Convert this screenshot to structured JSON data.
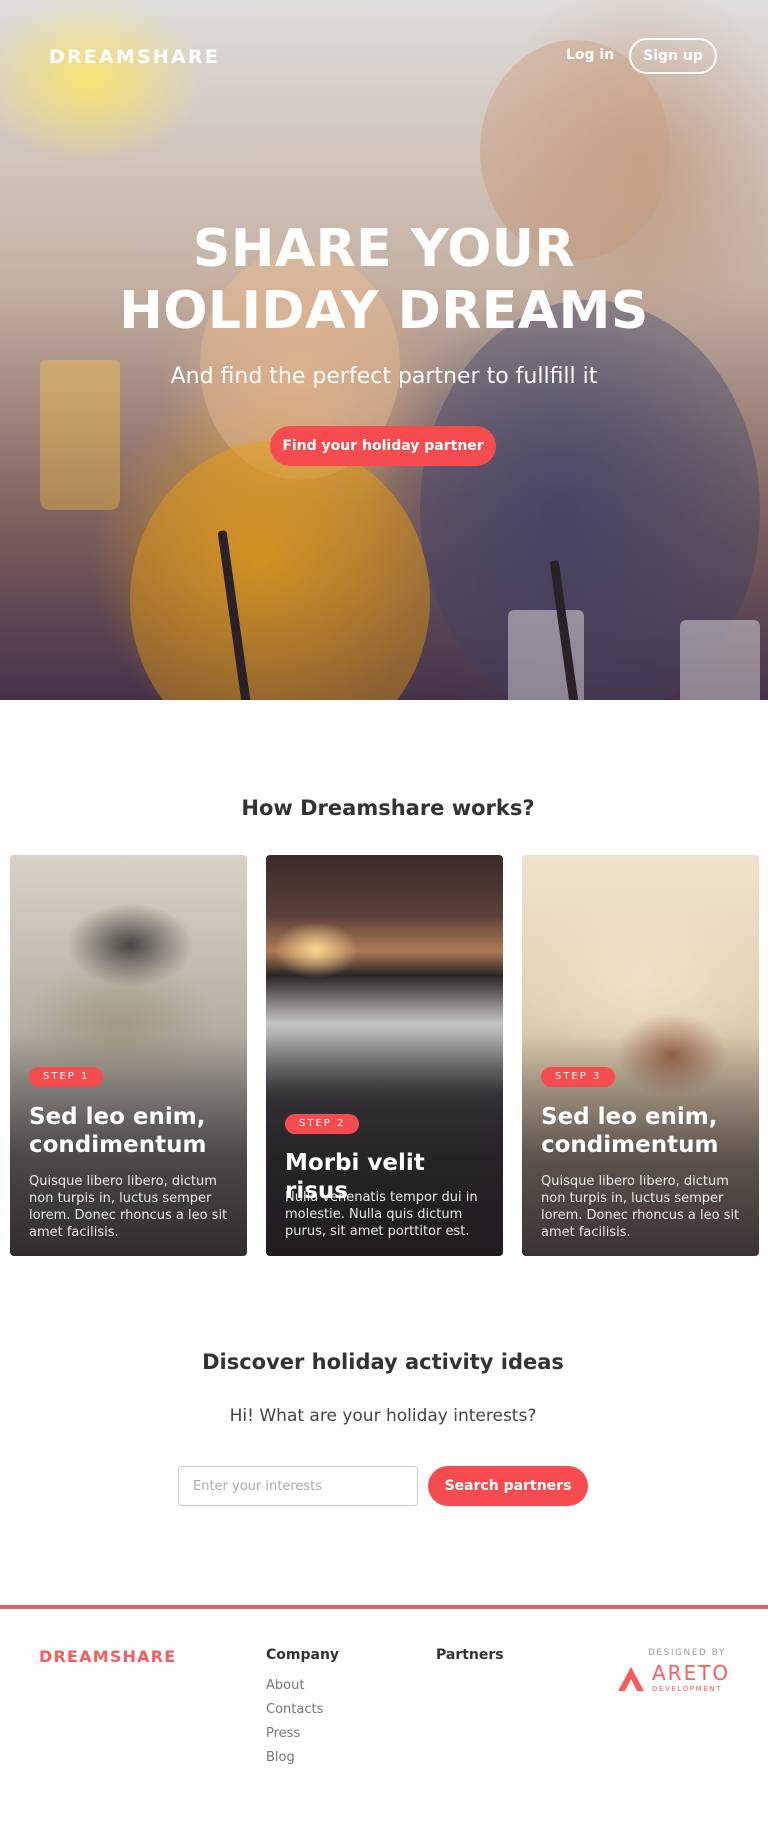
{
  "nav": {
    "logo": "DREAMSHARE",
    "login": "Log in",
    "signup": "Sign up"
  },
  "hero": {
    "title_line1": "SHARE YOUR",
    "title_line2": "HOLIDAY DREAMS",
    "subtitle": "And find the perfect partner to fullfill it",
    "cta": "Find your holiday partner"
  },
  "how": {
    "title": "How Dreamshare works?",
    "cards": [
      {
        "step": "STEP 1",
        "title": "Sed leo enim, condimentum",
        "text": "Quisque libero libero, dictum non turpis in, luctus semper lorem. Donec rhoncus a leo sit amet facilisis."
      },
      {
        "step": "STEP 2",
        "title": "Morbi velit risus",
        "text": "Nulla venenatis tempor dui in molestie. Nulla quis dictum purus, sit amet porttitor est."
      },
      {
        "step": "STEP 3",
        "title": "Sed leo enim, condimentum",
        "text": "Quisque libero libero, dictum non turpis in, luctus semper lorem. Donec rhoncus a leo sit amet facilisis."
      }
    ]
  },
  "discover": {
    "title": "Discover holiday activity ideas",
    "subtitle": "Hi! What are your holiday interests?",
    "input_placeholder": "Enter your interests",
    "button": "Search partners"
  },
  "footer": {
    "logo": "DREAMSHARE",
    "company_heading": "Company",
    "company_links": [
      "About",
      "Contacts",
      "Press",
      "Blog"
    ],
    "partners_heading": "Partners",
    "designed_by": "DESIGNED BY",
    "designer_name": "ARETO",
    "designer_sub": "DEVELOPMENT"
  },
  "colors": {
    "accent": "#f74c4f",
    "footer_accent": "#f65d5f",
    "text_dark": "#333333",
    "text_muted": "#777777"
  }
}
